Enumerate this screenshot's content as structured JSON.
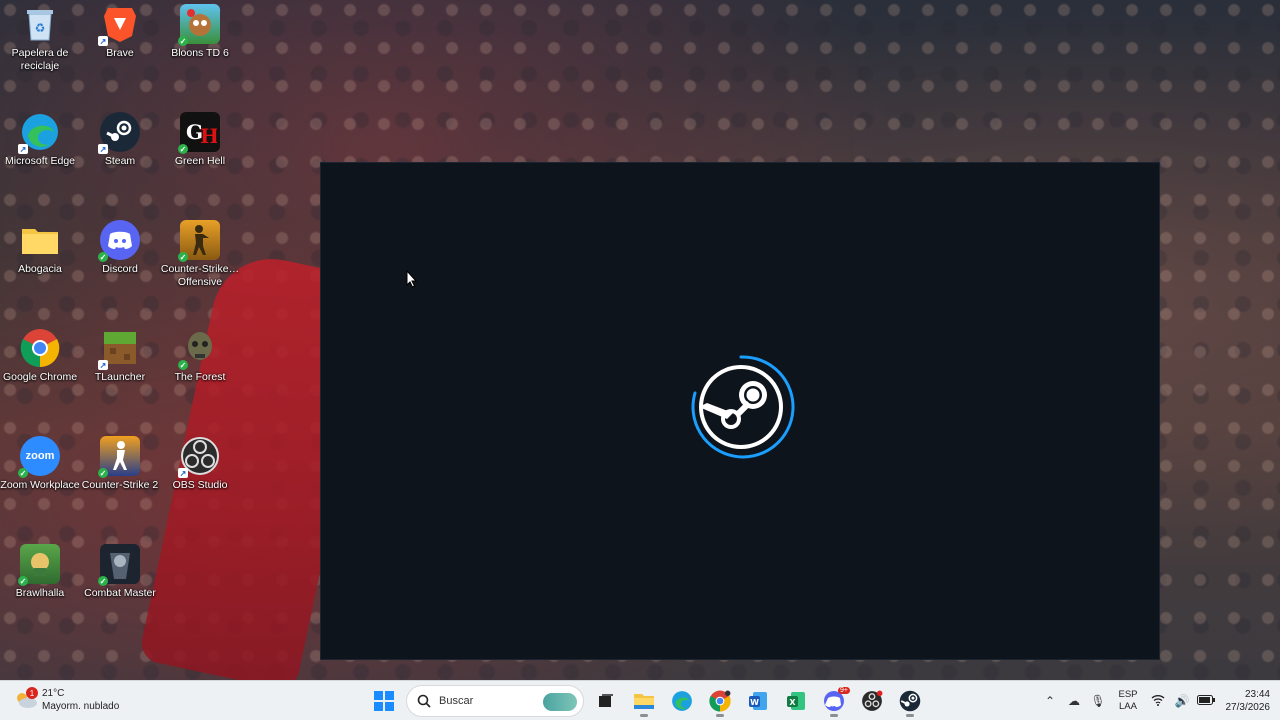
{
  "desktop": {
    "icons": [
      {
        "label": "Papelera de reciclaje",
        "icon": "recycle-bin-icon"
      },
      {
        "label": "Brave",
        "icon": "brave-icon"
      },
      {
        "label": "Bloons TD 6",
        "icon": "bloons-icon"
      },
      {
        "label": "Microsoft Edge",
        "icon": "edge-icon"
      },
      {
        "label": "Steam",
        "icon": "steam-icon"
      },
      {
        "label": "Green Hell",
        "icon": "green-hell-icon"
      },
      {
        "label": "Abogacia",
        "icon": "folder-icon"
      },
      {
        "label": "Discord",
        "icon": "discord-icon"
      },
      {
        "label": "Counter-Strike… Offensive",
        "icon": "csgo-icon"
      },
      {
        "label": "Google Chrome",
        "icon": "chrome-icon"
      },
      {
        "label": "TLauncher",
        "icon": "tlauncher-icon"
      },
      {
        "label": "The Forest",
        "icon": "the-forest-icon"
      },
      {
        "label": "Zoom Workplace",
        "icon": "zoom-icon",
        "glyph": "zoom"
      },
      {
        "label": "Counter-Strike 2",
        "icon": "cs2-icon"
      },
      {
        "label": "OBS Studio",
        "icon": "obs-icon"
      },
      {
        "label": "Brawlhalla",
        "icon": "brawlhalla-icon"
      },
      {
        "label": "Combat Master",
        "icon": "combat-master-icon"
      }
    ]
  },
  "splash": {
    "app": "Steam",
    "icon": "steam-logo-loading-icon"
  },
  "taskbar": {
    "weather": {
      "temp": "21°C",
      "condition": "Mayorm. nublado",
      "notifications": "1"
    },
    "search_placeholder": "Buscar",
    "discord_badge": "9+",
    "language": {
      "line1": "ESP",
      "line2": "LAA"
    },
    "clock": {
      "time": "23:44",
      "date": "27/3/2026"
    }
  },
  "colors": {
    "splash_bg": "#0e141b",
    "steam_blue": "#1a9fff",
    "taskbar_bg": "#eef1f4"
  }
}
